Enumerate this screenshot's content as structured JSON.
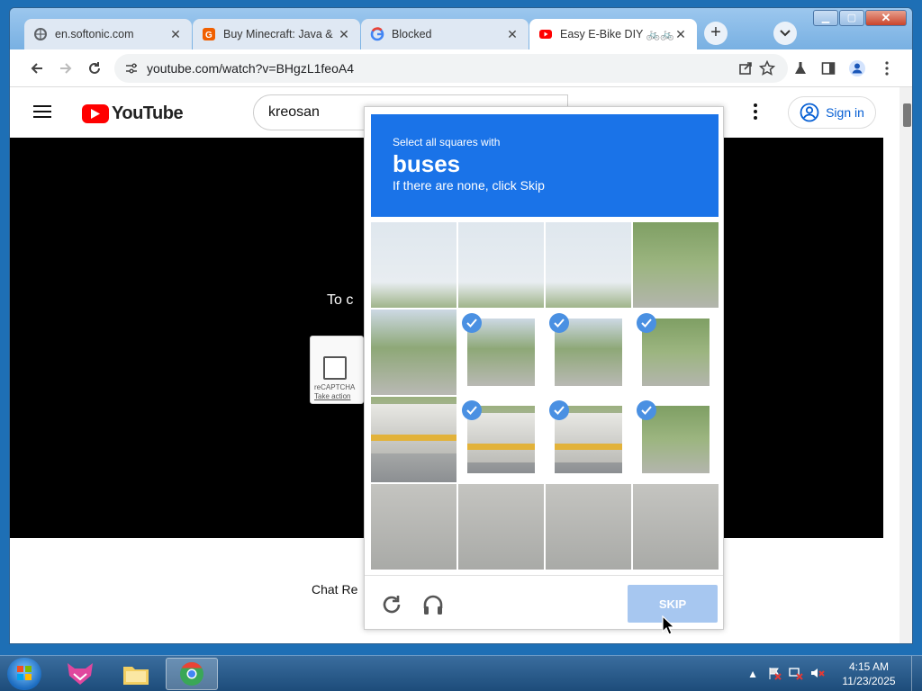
{
  "tabs": [
    {
      "title": "en.softonic.com",
      "icon": "globe-icon"
    },
    {
      "title": "Buy Minecraft: Java &",
      "icon": "g2a-icon"
    },
    {
      "title": "Blocked",
      "icon": "google-icon"
    },
    {
      "title": "Easy E-Bike DIY 🚲🚲 V",
      "icon": "youtube-icon"
    }
  ],
  "address": {
    "url": "youtube.com/watch?v=BHgzL1feoA4"
  },
  "youtube": {
    "logo_text": "YouTube",
    "search_value": "kreosan",
    "sign_in": "Sign in",
    "player_text": "To c",
    "chat_text": "Chat Re"
  },
  "recaptcha_anchor": {
    "label": "reCAPTCHA",
    "link": "Take action"
  },
  "captcha": {
    "instruction_small": "Select all squares with",
    "target": "buses",
    "instruction_sub": "If there are none, click Skip",
    "skip_label": "SKIP",
    "selected_tiles": [
      5,
      6,
      7,
      9,
      10,
      11
    ]
  },
  "taskbar": {
    "time": "4:15 AM",
    "date": "11/23/2025"
  },
  "colors": {
    "captcha_blue": "#1a73e8",
    "skip_disabled": "#a7c7f0",
    "check_blue": "#4a90e2"
  }
}
